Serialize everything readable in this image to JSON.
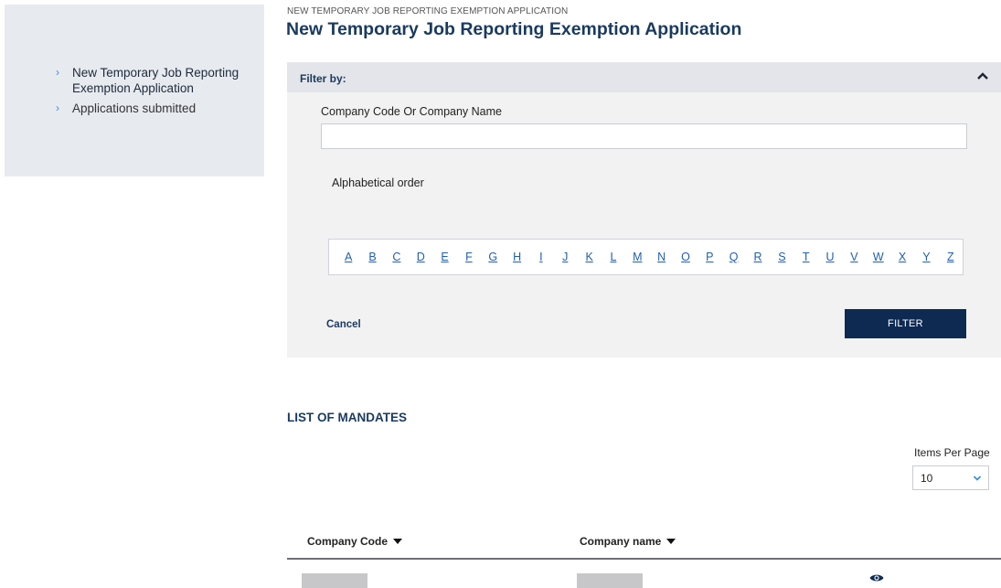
{
  "sidebar": {
    "items": [
      {
        "label": "New Temporary Job Reporting Exemption Application",
        "active": true
      },
      {
        "label": "Applications submitted",
        "active": false
      }
    ]
  },
  "header": {
    "breadcrumb": "NEW TEMPORARY JOB REPORTING EXEMPTION APPLICATION",
    "title": "New Temporary Job Reporting Exemption Application"
  },
  "filter": {
    "title": "Filter by:",
    "company_label": "Company Code Or Company Name",
    "company_value": "",
    "alpha_label": "Alphabetical order",
    "letters": [
      "A",
      "B",
      "C",
      "D",
      "E",
      "F",
      "G",
      "H",
      "I",
      "J",
      "K",
      "L",
      "M",
      "N",
      "O",
      "P",
      "Q",
      "R",
      "S",
      "T",
      "U",
      "V",
      "W",
      "X",
      "Y",
      "Z"
    ],
    "cancel_label": "Cancel",
    "filter_label": "FILTER"
  },
  "list": {
    "title": "LIST OF MANDATES",
    "items_per_page_label": "Items Per Page",
    "items_per_page_value": "10",
    "columns": [
      "Company Code",
      "Company name"
    ]
  },
  "colors": {
    "accent_dark": "#0e2a52",
    "title_blue": "#1a3a5e",
    "link_blue": "#1f5fb0",
    "chevron_blue": "#3a8fd6"
  }
}
